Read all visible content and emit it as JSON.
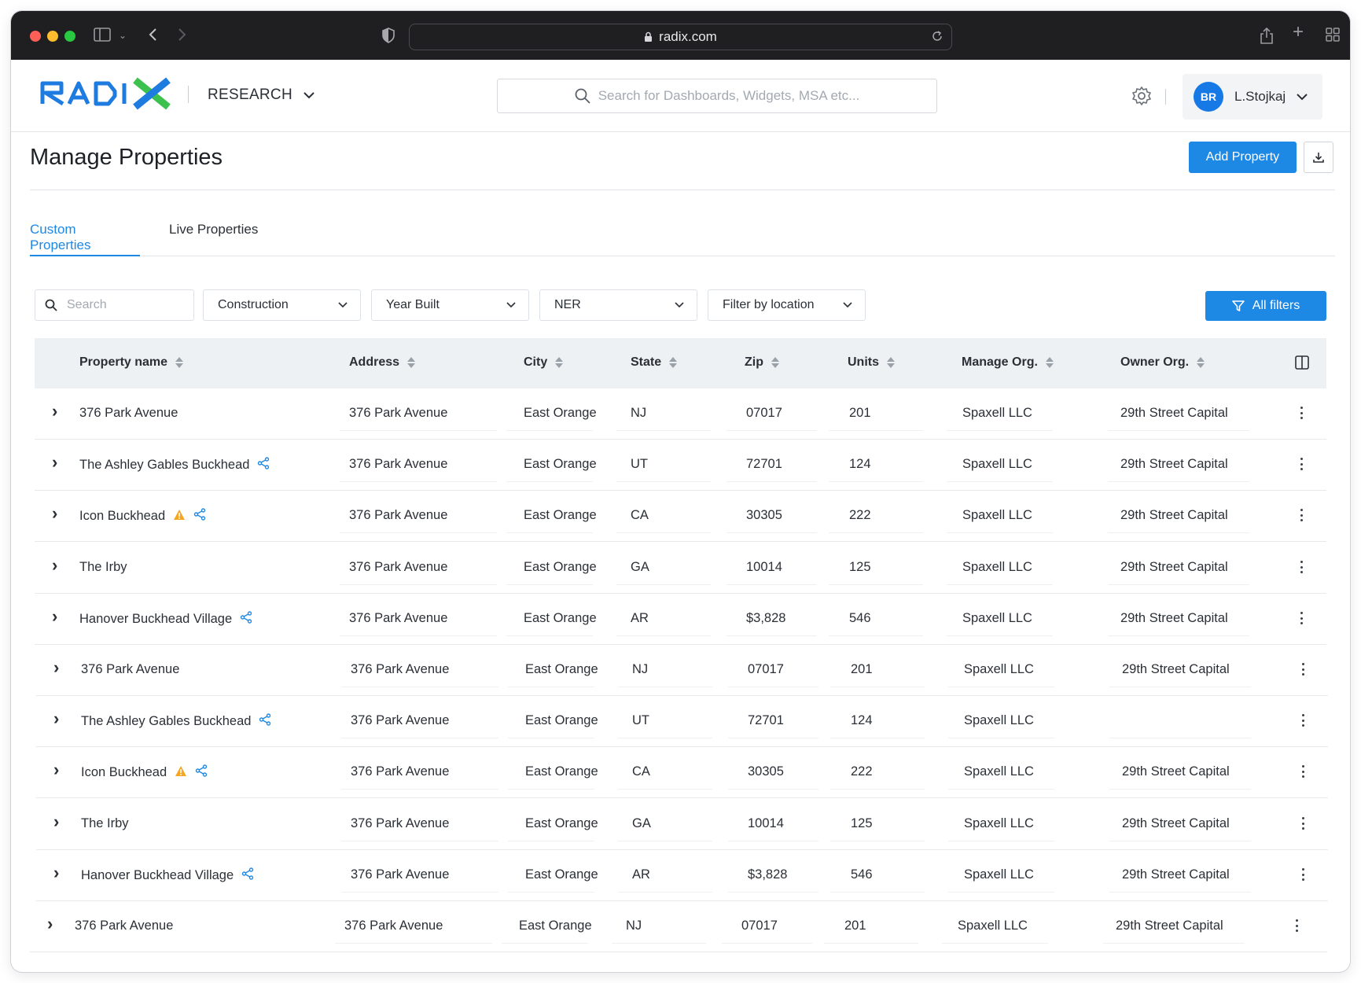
{
  "browser": {
    "url": "radix.com"
  },
  "header": {
    "logo_text": "RADIX",
    "module": "RESEARCH",
    "search_placeholder": "Search for Dashboards, Widgets, MSA etc...",
    "user": {
      "initials": "BR",
      "name": "L.Stojkaj"
    }
  },
  "page": {
    "title": "Manage Properties",
    "add_button": "Add Property"
  },
  "tabs": [
    {
      "label": "Custom Properties",
      "active": true
    },
    {
      "label": "Live Properties",
      "active": false
    }
  ],
  "filters": {
    "search_placeholder": "Search",
    "dropdowns": [
      "Construction",
      "Year Built",
      "NER",
      "Filter by location"
    ],
    "all_filters_label": "All filters"
  },
  "table": {
    "columns": [
      "Property name",
      "Address",
      "City",
      "State",
      "Zip",
      "Units",
      "Manage Org.",
      "Owner Org."
    ],
    "rows": [
      {
        "name": "376 Park Avenue",
        "address": "376 Park Avenue",
        "city": "East Orange",
        "state": "NJ",
        "zip": "07017",
        "units": "201",
        "manage": "Spaxell LLC",
        "owner": "29th Street Capital",
        "warning": false,
        "shared": false
      },
      {
        "name": "The Ashley Gables Buckhead",
        "address": "376 Park Avenue",
        "city": "East Orange",
        "state": "UT",
        "zip": "72701",
        "units": "124",
        "manage": "Spaxell LLC",
        "owner": "29th Street Capital",
        "warning": false,
        "shared": true
      },
      {
        "name": "Icon Buckhead",
        "address": "376 Park Avenue",
        "city": "East Orange",
        "state": "CA",
        "zip": "30305",
        "units": "222",
        "manage": "Spaxell LLC",
        "owner": "29th Street Capital",
        "warning": true,
        "shared": true
      },
      {
        "name": "The Irby",
        "address": "376 Park Avenue",
        "city": "East Orange",
        "state": "GA",
        "zip": "10014",
        "units": "125",
        "manage": "Spaxell LLC",
        "owner": "29th Street Capital",
        "warning": false,
        "shared": false
      },
      {
        "name": "Hanover Buckhead Village",
        "address": "376 Park Avenue",
        "city": "East Orange",
        "state": "AR",
        "zip": "$3,828",
        "units": "546",
        "manage": "Spaxell LLC",
        "owner": "29th Street Capital",
        "warning": false,
        "shared": true
      },
      {
        "name": "376 Park Avenue",
        "address": "376 Park Avenue",
        "city": "East Orange",
        "state": "NJ",
        "zip": "07017",
        "units": "201",
        "manage": "Spaxell LLC",
        "owner": "29th Street Capital",
        "warning": false,
        "shared": false
      },
      {
        "name": "The Ashley Gables Buckhead",
        "address": "376 Park Avenue",
        "city": "East Orange",
        "state": "UT",
        "zip": "72701",
        "units": "124",
        "manage": "Spaxell LLC",
        "owner": "",
        "warning": false,
        "shared": true
      },
      {
        "name": "Icon Buckhead",
        "address": "376 Park Avenue",
        "city": "East Orange",
        "state": "CA",
        "zip": "30305",
        "units": "222",
        "manage": "Spaxell LLC",
        "owner": "29th Street Capital",
        "warning": true,
        "shared": true
      },
      {
        "name": "The Irby",
        "address": "376 Park Avenue",
        "city": "East Orange",
        "state": "GA",
        "zip": "10014",
        "units": "125",
        "manage": "Spaxell LLC",
        "owner": "29th Street Capital",
        "warning": false,
        "shared": false
      },
      {
        "name": "Hanover Buckhead Village",
        "address": "376 Park Avenue",
        "city": "East Orange",
        "state": "AR",
        "zip": "$3,828",
        "units": "546",
        "manage": "Spaxell LLC",
        "owner": "29th Street Capital",
        "warning": false,
        "shared": true
      },
      {
        "name": "376 Park Avenue",
        "address": "376 Park Avenue",
        "city": "East Orange",
        "state": "NJ",
        "zip": "07017",
        "units": "201",
        "manage": "Spaxell LLC",
        "owner": "29th Street Capital",
        "warning": false,
        "shared": false
      }
    ]
  },
  "colors": {
    "accent": "#1e88e5",
    "logo_blue": "#1e7be0",
    "logo_green": "#3cc14e",
    "warning": "#f5a623",
    "chrome_bg": "#1f1f21"
  },
  "icons": [
    "sidebar-icon",
    "back-icon",
    "forward-icon",
    "shield-icon",
    "lock-icon",
    "reload-icon",
    "share-icon",
    "new-tab-icon",
    "tabs-grid-icon",
    "search-icon",
    "gear-icon",
    "chevron-down-icon",
    "download-icon",
    "filter-icon",
    "sort-icon",
    "columns-icon",
    "expand-icon",
    "warning-icon",
    "more-icon"
  ]
}
